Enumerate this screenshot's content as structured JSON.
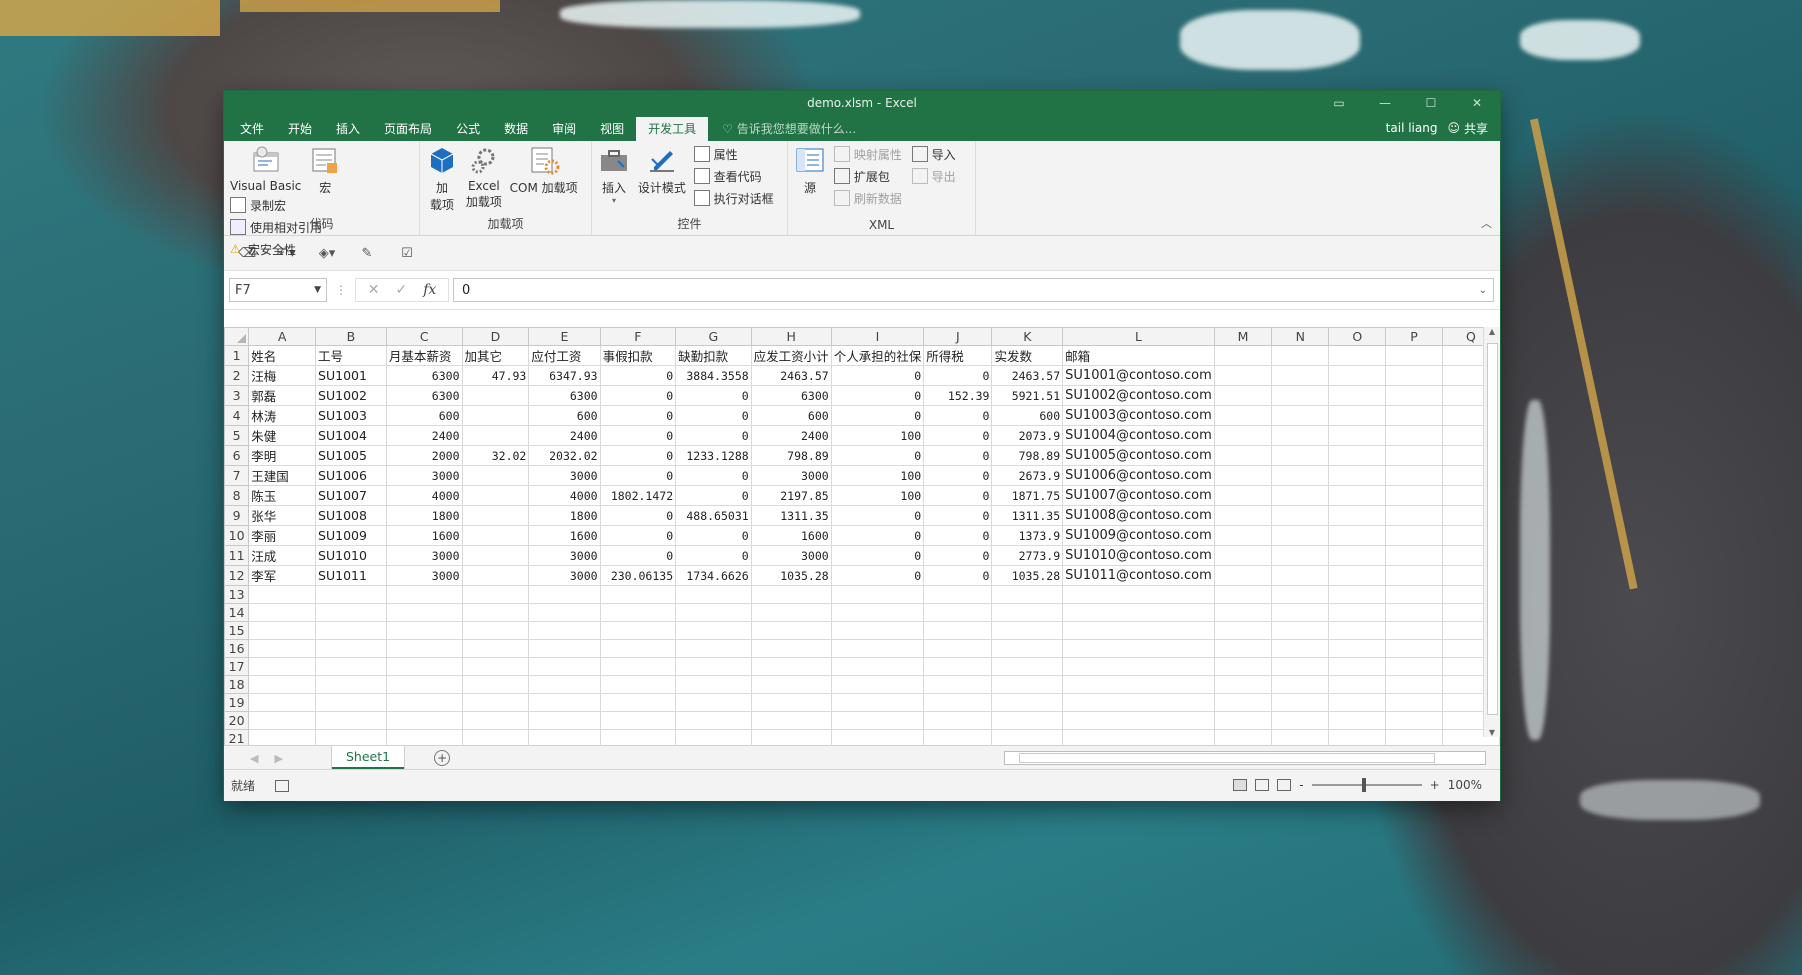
{
  "window": {
    "title": "demo.xlsm - Excel"
  },
  "tabs": [
    "文件",
    "开始",
    "插入",
    "页面布局",
    "公式",
    "数据",
    "审阅",
    "视图",
    "开发工具"
  ],
  "active_tab": "开发工具",
  "tell_me": "告诉我您想要做什么...",
  "user": {
    "name": "tail liang",
    "share": "共享"
  },
  "ribbon": {
    "code": {
      "name": "代码",
      "visual_basic": "Visual Basic",
      "macro": "宏",
      "record": "录制宏",
      "relative": "使用相对引用",
      "security": "宏安全性"
    },
    "addins": {
      "name": "加载项",
      "add": "加\n载项",
      "add_a": "加",
      "add_b": "载项",
      "excel_a": "Excel",
      "excel_b": "加载项",
      "com": "COM 加载项"
    },
    "controls": {
      "name": "控件",
      "insert": "插入",
      "design": "设计模式",
      "properties": "属性",
      "view_code": "查看代码",
      "run_dialog": "执行对话框"
    },
    "xml": {
      "name": "XML",
      "source": "源",
      "map_props": "映射属性",
      "expansion": "扩展包",
      "refresh": "刷新数据",
      "import": "导入",
      "export": "导出"
    }
  },
  "formula_bar": {
    "name_box": "F7",
    "value": "0"
  },
  "columns": [
    "A",
    "B",
    "C",
    "D",
    "E",
    "F",
    "G",
    "H",
    "I",
    "J",
    "K",
    "L",
    "M",
    "N",
    "O",
    "P",
    "Q"
  ],
  "header_row": [
    "姓名",
    "工号",
    "月基本薪资",
    "加其它",
    "应付工资",
    "事假扣款",
    "缺勤扣款",
    "应发工资小计",
    "个人承担的社保",
    "所得税",
    "实发数",
    "邮箱"
  ],
  "rows": [
    [
      "汪梅",
      "SU1001",
      "6300",
      "47.93",
      "6347.93",
      "0",
      "3884.3558",
      "2463.57",
      "0",
      "0",
      "2463.57",
      "SU1001@contoso.com"
    ],
    [
      "郭磊",
      "SU1002",
      "6300",
      "",
      "6300",
      "0",
      "0",
      "6300",
      "0",
      "152.39",
      "5921.51",
      "SU1002@contoso.com"
    ],
    [
      "林涛",
      "SU1003",
      "600",
      "",
      "600",
      "0",
      "0",
      "600",
      "0",
      "0",
      "600",
      "SU1003@contoso.com"
    ],
    [
      "朱健",
      "SU1004",
      "2400",
      "",
      "2400",
      "0",
      "0",
      "2400",
      "100",
      "0",
      "2073.9",
      "SU1004@contoso.com"
    ],
    [
      "李明",
      "SU1005",
      "2000",
      "32.02",
      "2032.02",
      "0",
      "1233.1288",
      "798.89",
      "0",
      "0",
      "798.89",
      "SU1005@contoso.com"
    ],
    [
      "王建国",
      "SU1006",
      "3000",
      "",
      "3000",
      "0",
      "0",
      "3000",
      "100",
      "0",
      "2673.9",
      "SU1006@contoso.com"
    ],
    [
      "陈玉",
      "SU1007",
      "4000",
      "",
      "4000",
      "1802.1472",
      "0",
      "2197.85",
      "100",
      "0",
      "1871.75",
      "SU1007@contoso.com"
    ],
    [
      "张华",
      "SU1008",
      "1800",
      "",
      "1800",
      "0",
      "488.65031",
      "1311.35",
      "0",
      "0",
      "1311.35",
      "SU1008@contoso.com"
    ],
    [
      "李丽",
      "SU1009",
      "1600",
      "",
      "1600",
      "0",
      "0",
      "1600",
      "0",
      "0",
      "1373.9",
      "SU1009@contoso.com"
    ],
    [
      "汪成",
      "SU1010",
      "3000",
      "",
      "3000",
      "0",
      "0",
      "3000",
      "0",
      "0",
      "2773.9",
      "SU1010@contoso.com"
    ],
    [
      "李军",
      "SU1011",
      "3000",
      "",
      "3000",
      "230.06135",
      "1734.6626",
      "1035.28",
      "0",
      "0",
      "1035.28",
      "SU1011@contoso.com"
    ]
  ],
  "visible_rows": 21,
  "sheet_tab": "Sheet1",
  "status": {
    "ready": "就绪",
    "zoom": "100%"
  },
  "colors": {
    "excel_green": "#217346"
  }
}
